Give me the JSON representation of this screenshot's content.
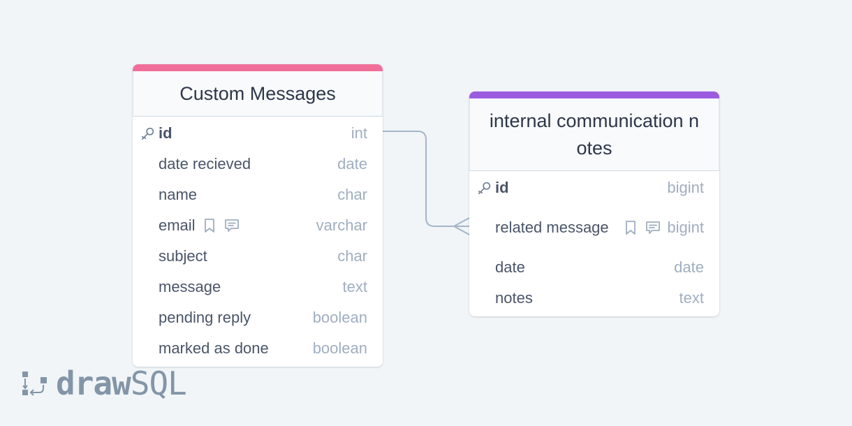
{
  "colors": {
    "background": "#f1f5f8",
    "custom_messages_accent": "#f06e99",
    "internal_notes_accent": "#9b5ce0",
    "connector": "#a6b5c6"
  },
  "tables": [
    {
      "title": "Custom Messages",
      "columns": [
        {
          "name": "id",
          "type": "int",
          "primary_key": true
        },
        {
          "name": "date recieved",
          "type": "date"
        },
        {
          "name": "name",
          "type": "char"
        },
        {
          "name": "email",
          "type": "varchar",
          "icons": [
            "bookmark-icon",
            "comment-icon"
          ]
        },
        {
          "name": "subject",
          "type": "char"
        },
        {
          "name": "message",
          "type": "text"
        },
        {
          "name": "pending reply",
          "type": "boolean"
        },
        {
          "name": "marked as done",
          "type": "boolean"
        }
      ]
    },
    {
      "title": "internal communication notes",
      "columns": [
        {
          "name": "id",
          "type": "bigint",
          "primary_key": true
        },
        {
          "name": "related message",
          "type": "bigint",
          "icons": [
            "bookmark-icon",
            "comment-icon"
          ]
        },
        {
          "name": "date",
          "type": "date"
        },
        {
          "name": "notes",
          "type": "text"
        }
      ]
    }
  ],
  "relationship": {
    "from": "Custom Messages.id",
    "to": "internal communication notes.related message",
    "cardinality": "one-to-many"
  },
  "brand": {
    "part1": "draw",
    "part2": "SQL"
  }
}
